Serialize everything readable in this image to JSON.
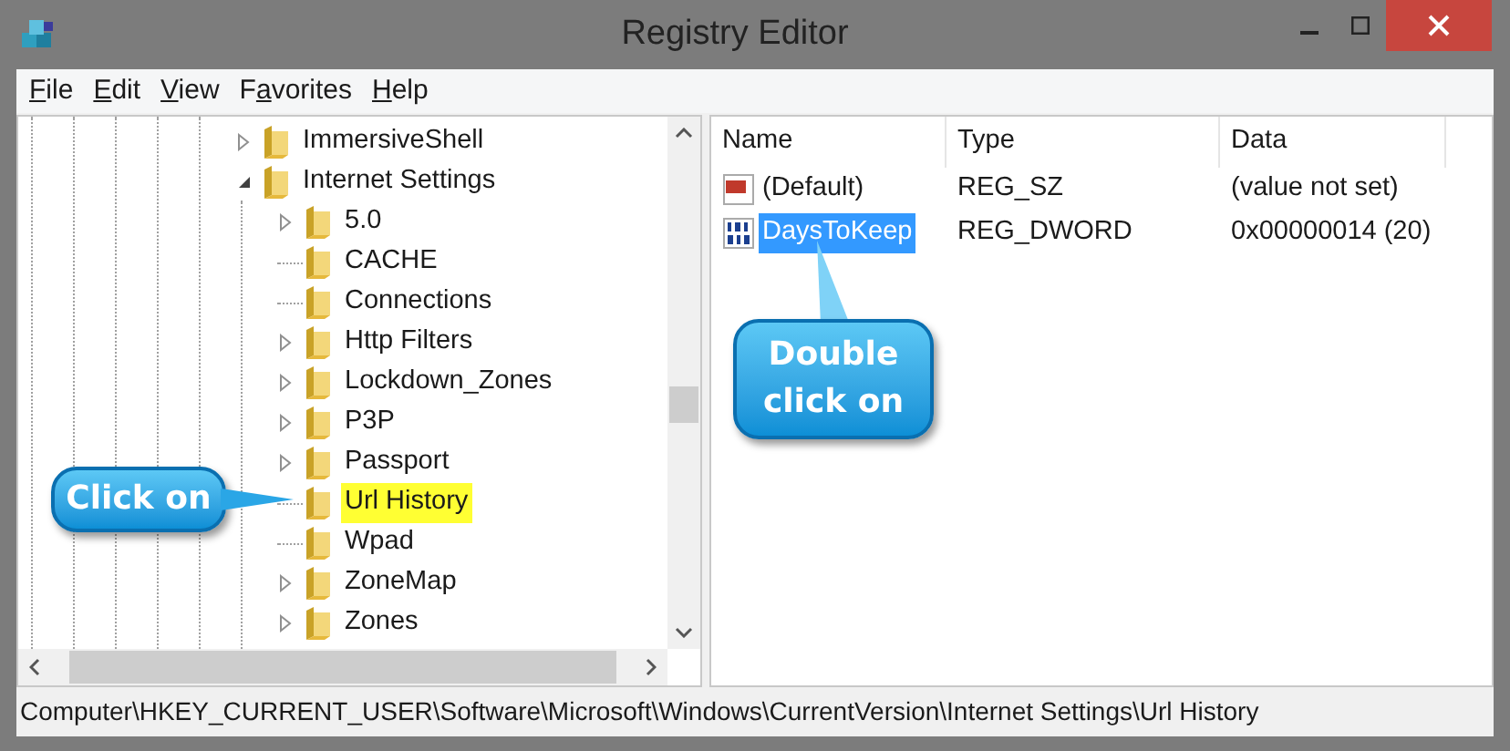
{
  "window": {
    "title": "Registry Editor"
  },
  "menu": [
    {
      "key": "F",
      "post": "ile"
    },
    {
      "key": "E",
      "post": "dit"
    },
    {
      "key": "V",
      "post": "iew"
    },
    {
      "pre": "F",
      "key": "a",
      "post": "vorites"
    },
    {
      "key": "H",
      "post": "elp"
    }
  ],
  "tree": [
    {
      "label": "ImmersiveShell",
      "expanded": false,
      "highlighted": false
    },
    {
      "label": "Internet Settings",
      "expanded": true,
      "highlighted": false,
      "children": [
        {
          "label": "5.0",
          "expanded": false,
          "highlighted": false
        },
        {
          "label": "CACHE",
          "highlighted": false
        },
        {
          "label": "Connections",
          "highlighted": false
        },
        {
          "label": "Http Filters",
          "expanded": false,
          "highlighted": false
        },
        {
          "label": "Lockdown_Zones",
          "expanded": false,
          "highlighted": false
        },
        {
          "label": "P3P",
          "expanded": false,
          "highlighted": false
        },
        {
          "label": "Passport",
          "expanded": false,
          "highlighted": false
        },
        {
          "label": "Url History",
          "highlighted": true
        },
        {
          "label": "Wpad",
          "highlighted": false
        },
        {
          "label": "ZoneMap",
          "expanded": false,
          "highlighted": false
        },
        {
          "label": "Zones",
          "expanded": false,
          "highlighted": false
        }
      ]
    }
  ],
  "values": {
    "columns": [
      "Name",
      "Type",
      "Data"
    ],
    "rows": [
      {
        "kind": "string",
        "name": "(Default)",
        "type": "REG_SZ",
        "data": "(value not set)",
        "selected": false
      },
      {
        "kind": "binary",
        "name": "DaysToKeep",
        "type": "REG_DWORD",
        "data": "0x00000014 (20)",
        "selected": true
      }
    ]
  },
  "status_bar": "Computer\\HKEY_CURRENT_USER\\Software\\Microsoft\\Windows\\CurrentVersion\\Internet Settings\\Url History",
  "callouts": [
    {
      "kind": "point-right",
      "text": "Click on"
    },
    {
      "kind": "point-up",
      "text": "Double click on"
    }
  ]
}
